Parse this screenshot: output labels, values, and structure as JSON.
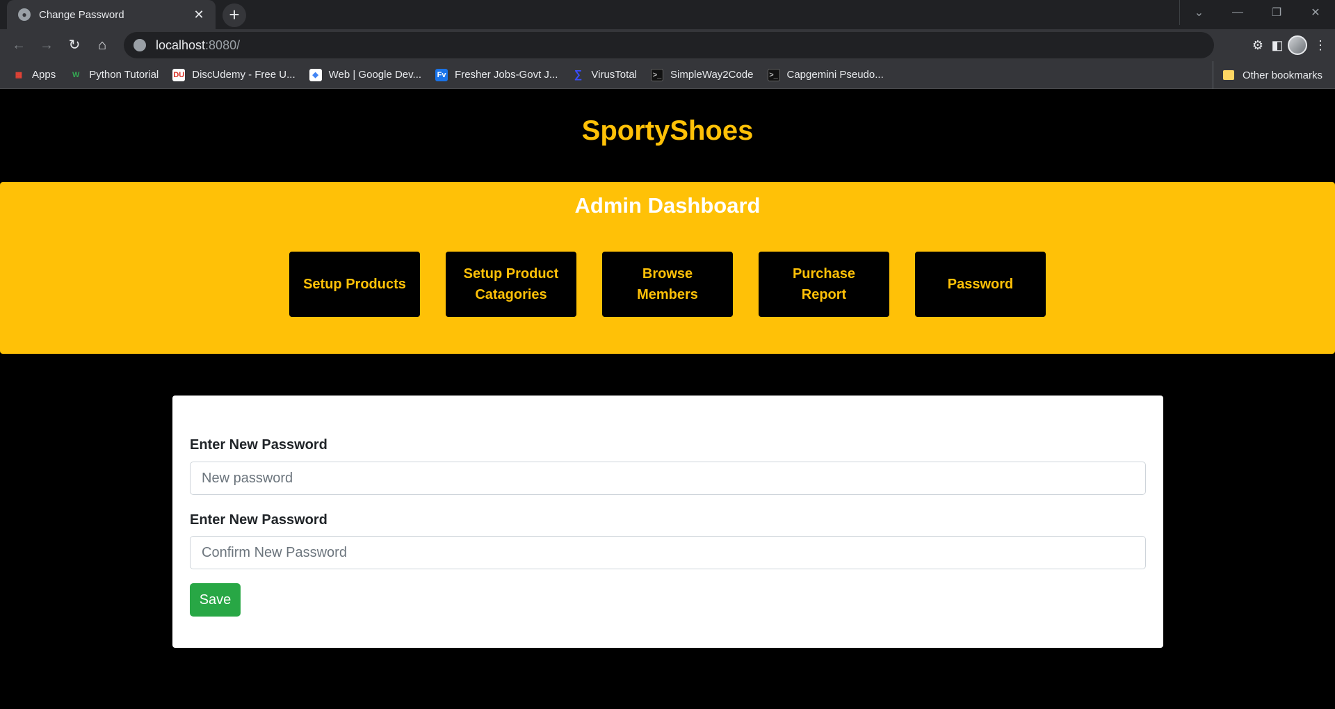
{
  "browser": {
    "tab_title": "Change Password",
    "url_host": "localhost",
    "url_rest": ":8080/",
    "bookmarks": [
      {
        "label": "Apps",
        "icon": "apps-grid-icon",
        "color": "#ea4335"
      },
      {
        "label": "Python Tutorial",
        "icon": "w-logo-icon",
        "color": "#34a853"
      },
      {
        "label": "DiscUdemy - Free U...",
        "icon": "discudemy-icon",
        "color": "#ffffff"
      },
      {
        "label": "Web  |  Google Dev...",
        "icon": "google-dev-icon",
        "color": "#ffffff"
      },
      {
        "label": "Fresher Jobs-Govt J...",
        "icon": "fv-icon",
        "color": "#1a73e8"
      },
      {
        "label": "VirusTotal",
        "icon": "virustotal-icon",
        "color": "#394eff"
      },
      {
        "label": "SimpleWay2Code",
        "icon": "terminal-icon",
        "color": "#202124"
      },
      {
        "label": "Capgemini Pseudo...",
        "icon": "terminal-icon",
        "color": "#202124"
      }
    ],
    "other_bookmarks": "Other bookmarks"
  },
  "page": {
    "brand": "SportyShoes",
    "dashboard_title": "Admin Dashboard",
    "nav": [
      {
        "label": "Setup Products"
      },
      {
        "label": "Setup Product Catagories"
      },
      {
        "label": "Browse Members"
      },
      {
        "label": "Purchase Report"
      },
      {
        "label": "Password"
      }
    ],
    "form": {
      "new_label": "Enter New Password",
      "new_placeholder": "New password",
      "confirm_label": "Enter New Password",
      "confirm_placeholder": "Confirm New Password",
      "save_label": "Save"
    }
  },
  "colors": {
    "accent": "#ffc107",
    "save": "#28a745",
    "background": "#000000"
  }
}
